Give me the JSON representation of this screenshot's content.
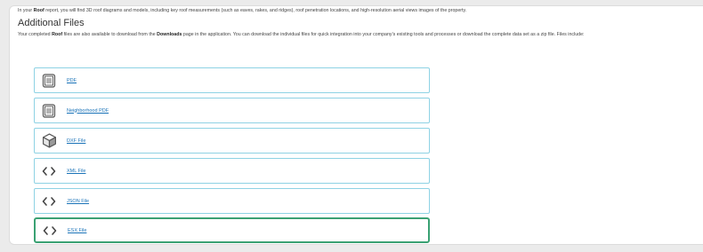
{
  "intro": {
    "prefix": "In your ",
    "bold": "Roof",
    "suffix": " report, you will find 3D roof diagrams and models, including key roof measurements (such as eaves, rakes, and ridges), roof penetration locations, and high-resolution aerial views images of the property."
  },
  "section": {
    "title": "Additional Files",
    "desc_part1": "Your completed ",
    "desc_bold1": "Roof",
    "desc_part2": " files are also available to download from the ",
    "desc_bold2": "Downloads",
    "desc_part3": " page in the application. You can download the individual files for quick integration into your company's existing tools and processes or download the complete data set as a zip file. Files include:"
  },
  "files": [
    {
      "label": "PDF",
      "icon": "document-icon"
    },
    {
      "label": "Neighborhood PDF",
      "icon": "document-icon"
    },
    {
      "label": "DXF File",
      "icon": "cube-icon"
    },
    {
      "label": "XML File",
      "icon": "code-icon"
    },
    {
      "label": "JSON File",
      "icon": "code-icon"
    },
    {
      "label": "ESX File",
      "icon": "code-icon"
    }
  ],
  "colors": {
    "row_border": "#8ed2e4",
    "selected_border": "#3aa173",
    "link": "#1a73b8"
  }
}
